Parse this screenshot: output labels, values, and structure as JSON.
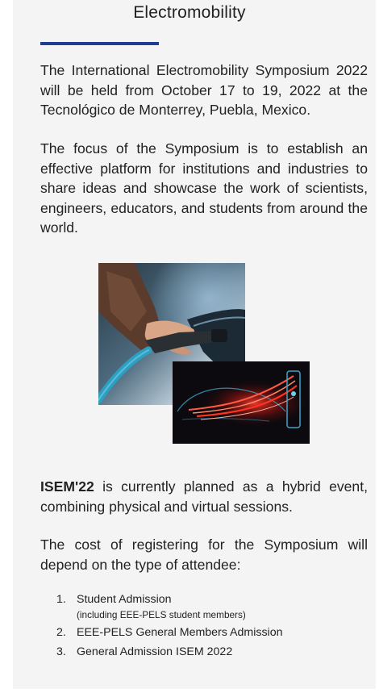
{
  "section": {
    "title": "Electromobility"
  },
  "paragraphs": {
    "intro": "The International Electromobility Symposium 2022 will be held from October 17 to 19, 2022 at the Tecnológico de Monterrey, Puebla, Mexico.",
    "focus": "The focus of the Symposium is to establish an effective platform for institutions and industries to share ideas and showcase the work of scientists, engineers, educators, and students from around the world.",
    "hybrid_bold": "ISEM'22",
    "hybrid_rest": " is currently planned as a hybrid event, combining physical and virtual sessions.",
    "cost": "The cost of registering for the Symposium will depend on the type of attendee:"
  },
  "admission_list": [
    {
      "number": "1.",
      "label": "Student Admission",
      "sub": "(including EEE-PELS student members)"
    },
    {
      "number": "2.",
      "label": "EEE-PELS General Members Admission"
    },
    {
      "number": "3.",
      "label": "General Admission ISEM 2022"
    }
  ],
  "colors": {
    "accent": "#1f3e8f",
    "card_background": "#f4f4f4",
    "text": "#222222"
  },
  "images": {
    "photo_1": "ev-charging-plug-photo",
    "photo_2": "red-light-trails-car-photo"
  }
}
